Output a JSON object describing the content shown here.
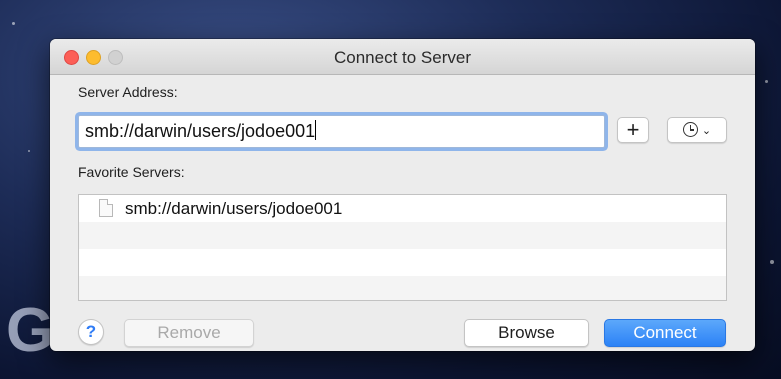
{
  "window": {
    "title": "Connect to Server"
  },
  "server_address": {
    "label": "Server Address:",
    "value": "smb://darwin/users/jodoe001"
  },
  "buttons": {
    "add_symbol": "+",
    "recent_chevron": "⌄",
    "remove": "Remove",
    "browse": "Browse",
    "connect": "Connect",
    "help": "?"
  },
  "favorites": {
    "label": "Favorite Servers:",
    "items": [
      "smb://darwin/users/jodoe001"
    ]
  },
  "colors": {
    "accent": "#2c82f6",
    "close": "#fc5f57",
    "minimize": "#fdbc2e",
    "focus_ring": "#8fb5ea"
  },
  "icons": [
    "close-icon",
    "minimize-icon",
    "zoom-icon",
    "plus-icon",
    "clock-icon",
    "chevron-down-icon",
    "document-icon",
    "help-icon"
  ]
}
